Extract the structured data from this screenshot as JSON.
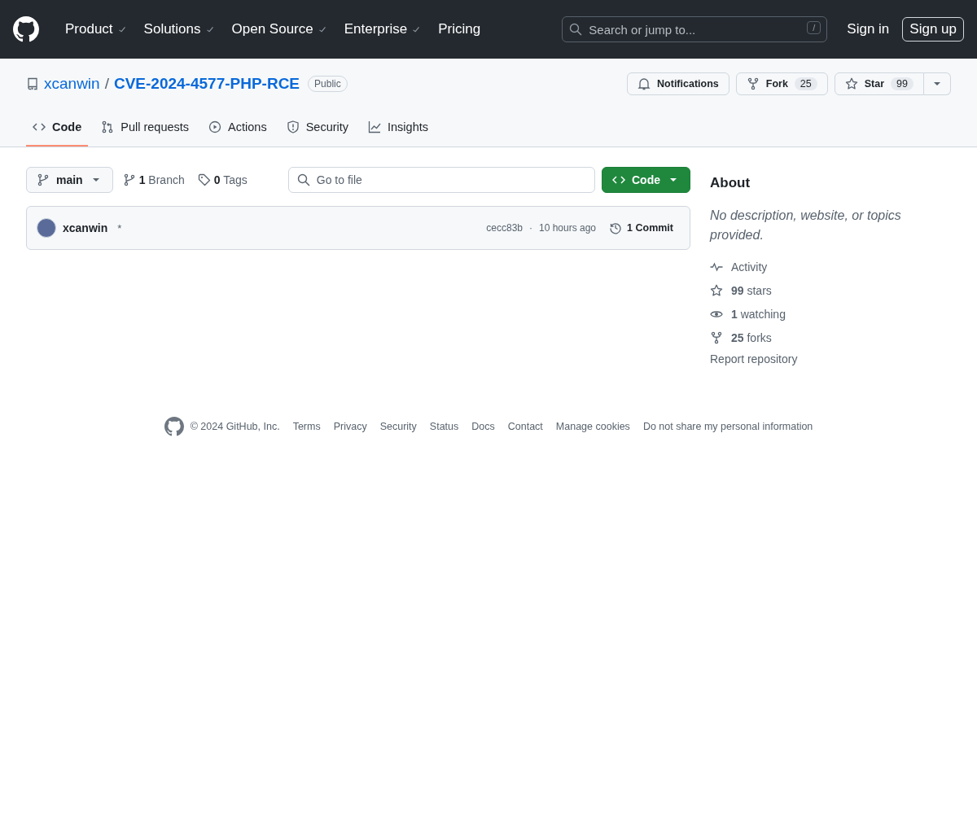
{
  "header": {
    "nav": [
      {
        "label": "Product",
        "dropdown": true
      },
      {
        "label": "Solutions",
        "dropdown": true
      },
      {
        "label": "Open Source",
        "dropdown": true
      },
      {
        "label": "Enterprise",
        "dropdown": true
      },
      {
        "label": "Pricing",
        "dropdown": false
      }
    ],
    "search": {
      "placeholder": "Search or jump to...",
      "shortcut": "/"
    },
    "sign_in": "Sign in",
    "sign_up": "Sign up"
  },
  "repo": {
    "owner": "xcanwin",
    "separator": "/",
    "name": "CVE-2024-4577-PHP-RCE",
    "visibility": "Public",
    "notifications": "Notifications",
    "fork": {
      "label": "Fork",
      "count": "25"
    },
    "star": {
      "label": "Star",
      "count": "99"
    }
  },
  "tabs": [
    {
      "label": "Code",
      "selected": true
    },
    {
      "label": "Pull requests",
      "selected": false
    },
    {
      "label": "Actions",
      "selected": false
    },
    {
      "label": "Security",
      "selected": false
    },
    {
      "label": "Insights",
      "selected": false
    }
  ],
  "toolbar": {
    "branch": "main",
    "branches": "**1** Branch",
    "tags": "**0** Tags",
    "file_search": {
      "placeholder": "Go to file"
    },
    "code_button": "Code"
  },
  "commit": {
    "author": "xcanwin",
    "message": "*",
    "hash": "cecc83b",
    "separator": "·",
    "time": "10 hours ago",
    "commits": "1 Commit"
  },
  "about": {
    "title": "About",
    "description": "No description, website, or topics provided.",
    "items": [
      {
        "text": "Activity"
      },
      {
        "text": "**99** stars"
      },
      {
        "text": "**1** watching"
      },
      {
        "text": "**25** forks"
      }
    ],
    "report": "Report repository"
  },
  "footer": {
    "copyright": "© 2024 GitHub, Inc.",
    "links": [
      "Terms",
      "Privacy",
      "Security",
      "Status",
      "Docs",
      "Contact",
      "Manage cookies",
      "Do not share my personal information"
    ]
  }
}
